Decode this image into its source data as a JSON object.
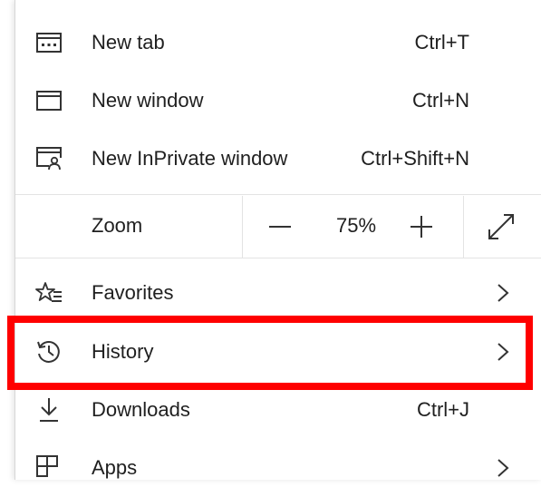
{
  "menu": {
    "new_tab": {
      "label": "New tab",
      "shortcut": "Ctrl+T",
      "icon": "new-tab-icon"
    },
    "new_window": {
      "label": "New window",
      "shortcut": "Ctrl+N",
      "icon": "new-window-icon"
    },
    "new_inprivate": {
      "label": "New InPrivate window",
      "shortcut": "Ctrl+Shift+N",
      "icon": "inprivate-icon"
    },
    "zoom": {
      "label": "Zoom",
      "value": "75%",
      "minus": "−",
      "plus": "+"
    },
    "favorites": {
      "label": "Favorites",
      "icon": "favorites-icon"
    },
    "history": {
      "label": "History",
      "icon": "history-icon"
    },
    "downloads": {
      "label": "Downloads",
      "shortcut": "Ctrl+J",
      "icon": "download-icon"
    },
    "apps": {
      "label": "Apps",
      "icon": "apps-icon"
    }
  },
  "colors": {
    "highlight": "#ff0000",
    "text": "#1f1f1f",
    "divider": "#e3e3e3"
  }
}
